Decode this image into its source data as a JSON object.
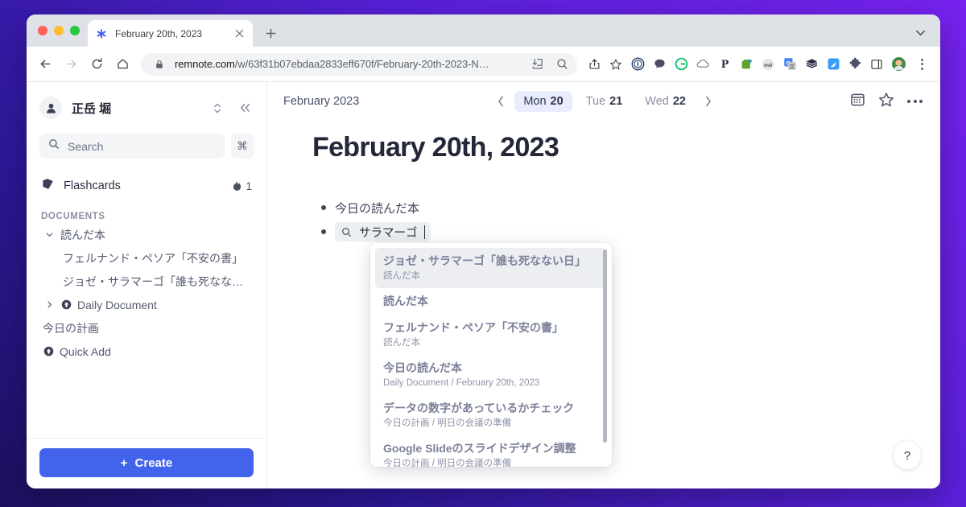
{
  "browser": {
    "tab": {
      "title": "February 20th, 2023",
      "favicon": "remnote-asterisk-icon",
      "close": "×"
    },
    "new_tab_label": "+",
    "url_main": "remnote.com",
    "url_rest": "/w/63f31b07ebdaa2833eff670f/February-20th-2023-N…",
    "omnibox_icons": [
      "lock-icon",
      "install-app-icon",
      "zoom-search-icon"
    ],
    "extensions": [
      {
        "name": "1password-extension",
        "glyph": "1"
      },
      {
        "name": "chat-extension",
        "glyph": "●"
      },
      {
        "name": "grammarly-extension",
        "glyph": "G"
      },
      {
        "name": "cloud-extension",
        "glyph": "☁"
      },
      {
        "name": "pocket-extension",
        "glyph": "P"
      },
      {
        "name": "evernote-extension",
        "glyph": "ᴇ"
      },
      {
        "name": "markdownload-extension",
        "glyph": "md"
      },
      {
        "name": "google-translate-extension",
        "glyph": "文"
      },
      {
        "name": "layers-extension",
        "glyph": "≣"
      },
      {
        "name": "bluebird-extension",
        "glyph": "✈"
      },
      {
        "name": "extensions-puzzle-icon",
        "glyph": "❖"
      },
      {
        "name": "side-panel-icon",
        "glyph": "□"
      },
      {
        "name": "profile-avatar",
        "glyph": "👤"
      }
    ]
  },
  "sidebar": {
    "user_name": "正岳 堀",
    "search_placeholder": "Search",
    "cmd_key": "⌘",
    "flashcards_label": "Flashcards",
    "streak_count": "1",
    "documents_header": "DOCUMENTS",
    "documents": [
      {
        "label": "読んだ本",
        "type": "expanded-parent",
        "level": 0
      },
      {
        "label": "フェルナンド・ペソア「不安の書」",
        "type": "child",
        "level": 1
      },
      {
        "label": "ジョゼ・サラマーゴ「誰も死なない…",
        "type": "child",
        "level": 1
      },
      {
        "label": "Daily Document",
        "type": "collapsed-parent-doc",
        "level": 0
      },
      {
        "label": "今日の計画",
        "type": "flat",
        "level": 0
      },
      {
        "label": "Quick Add",
        "type": "doc",
        "level": 0
      }
    ],
    "create_button": "Create",
    "create_plus": "+"
  },
  "main": {
    "month_label": "February 2023",
    "days": [
      {
        "name": "Mon",
        "num": "20",
        "active": true
      },
      {
        "name": "Tue",
        "num": "21",
        "active": false
      },
      {
        "name": "Wed",
        "num": "22",
        "active": false
      }
    ],
    "prev_arrow": "‹",
    "next_arrow": "›",
    "header_actions": [
      "calendar-icon",
      "star-icon",
      "more-options-icon"
    ],
    "page_title": "February 20th, 2023",
    "bullets": [
      {
        "kind": "text",
        "text": "今日の読んだ本"
      },
      {
        "kind": "search",
        "value": "サラマーゴ"
      }
    ],
    "help_button": "?"
  },
  "autocomplete": {
    "items": [
      {
        "title": "ジョゼ・サラマーゴ「誰も死なない日」",
        "sub": "読んだ本",
        "selected": true
      },
      {
        "title": "読んだ本",
        "sub": "",
        "selected": false
      },
      {
        "title": "フェルナンド・ペソア「不安の書」",
        "sub": "読んだ本",
        "selected": false
      },
      {
        "title": "今日の読んだ本",
        "sub": "Daily Document / February 20th, 2023",
        "selected": false
      },
      {
        "title": "データの数字があっているかチェック",
        "sub": "今日の計画 / 明日の会議の準備",
        "selected": false
      },
      {
        "title": "Google Slideのスライドデザイン調整",
        "sub": "今日の計画 / 明日の会議の準備",
        "selected": false
      }
    ]
  },
  "colors": {
    "accent_blue": "#4263eb",
    "selected_day_bg": "#e8ecfd",
    "background_purple": "#7722ef"
  }
}
